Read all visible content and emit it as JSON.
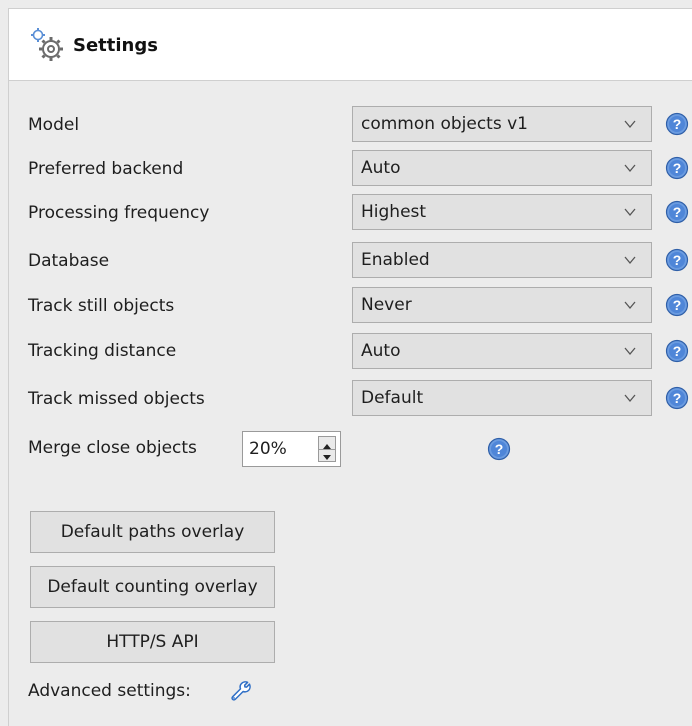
{
  "header": {
    "title": "Settings",
    "icon": "gears-icon"
  },
  "rows": [
    {
      "label": "Model",
      "value": "common objects v1"
    },
    {
      "label": "Preferred backend",
      "value": "Auto"
    },
    {
      "label": "Processing frequency",
      "value": "Highest"
    },
    {
      "label": "Database",
      "value": "Enabled"
    },
    {
      "label": "Track still objects",
      "value": "Never"
    },
    {
      "label": "Tracking distance",
      "value": "Auto"
    },
    {
      "label": "Track missed objects",
      "value": "Default"
    }
  ],
  "merge": {
    "label": "Merge close objects",
    "value": "20%"
  },
  "buttons": {
    "paths_overlay": "Default paths overlay",
    "counting_overlay": "Default counting overlay",
    "http_api": "HTTP/S API"
  },
  "advanced": {
    "label": "Advanced settings:",
    "icon": "wrench-icon"
  },
  "colors": {
    "help_blue": "#3b78d8",
    "accent": "#2f6fc6"
  }
}
